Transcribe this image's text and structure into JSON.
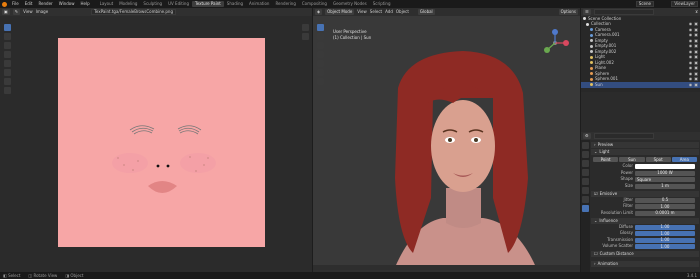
{
  "topbar": {
    "menus": [
      "File",
      "Edit",
      "Render",
      "Window",
      "Help"
    ],
    "workspaces": [
      "Layout",
      "Modeling",
      "Sculpting",
      "UV Editing",
      "Texture Paint",
      "Shading",
      "Animation",
      "Rendering",
      "Compositing",
      "Geometry Nodes",
      "Scripting"
    ],
    "active_workspace": "Texture Paint",
    "scene_label": "Scene",
    "viewlayer_label": "ViewLayer"
  },
  "image_editor": {
    "view": "View",
    "image": "Image",
    "filename": "TexPaint.tga/FemaleBrowsCombine.png"
  },
  "viewport": {
    "mode": "Object Mode",
    "menus": [
      "View",
      "Select",
      "Add",
      "Object"
    ],
    "transform": "Global",
    "options": "Options",
    "info_line1": "User Perspective",
    "info_line2": "(1) Collection | Sun"
  },
  "outliner": {
    "title": "Scene Collection",
    "collection": "Collection",
    "items": [
      {
        "name": "Camera",
        "color": "#6a9bd8"
      },
      {
        "name": "Camera.001",
        "color": "#6a9bd8"
      },
      {
        "name": "Empty",
        "color": "#c6c6c6"
      },
      {
        "name": "Empty.001",
        "color": "#c6c6c6"
      },
      {
        "name": "Empty.002",
        "color": "#c6c6c6"
      },
      {
        "name": "Light",
        "color": "#e0c060"
      },
      {
        "name": "Light.002",
        "color": "#e0c060"
      },
      {
        "name": "Plane",
        "color": "#e59a52"
      },
      {
        "name": "Sphere",
        "color": "#e59a52"
      },
      {
        "name": "Sphere.001",
        "color": "#e59a52"
      },
      {
        "name": "Sun",
        "color": "#e0c060"
      }
    ]
  },
  "properties": {
    "preview": "Preview",
    "light": "Light",
    "light_types": [
      "Point",
      "Sun",
      "Spot",
      "Area"
    ],
    "active_type": "Area",
    "color_label": "Color",
    "power_label": "Power",
    "power": "1000 W",
    "shape_label": "Shape",
    "shape": "Square",
    "size_label": "Size",
    "size": "1 m",
    "emissive": "Emissive",
    "jitter_label": "Jitter",
    "jitter": "0.5",
    "radius_label": "Filter",
    "radius": "1.00",
    "resolution_label": "Resolution Limit",
    "resolution": "0.0001 m",
    "influence": "Influence",
    "diffuse_label": "Diffuse",
    "diffuse": "1.00",
    "glossy_label": "Glossy",
    "glossy": "1.00",
    "transmission_label": "Transmission",
    "transmission": "1.00",
    "volume_label": "Volume Scatter",
    "volume": "1.00",
    "custom_distance": "Custom Distance",
    "animation": "Animation"
  },
  "status": {
    "select": "Select",
    "rotate": "Rotate View",
    "object": "Object",
    "version": "3.4.1"
  }
}
